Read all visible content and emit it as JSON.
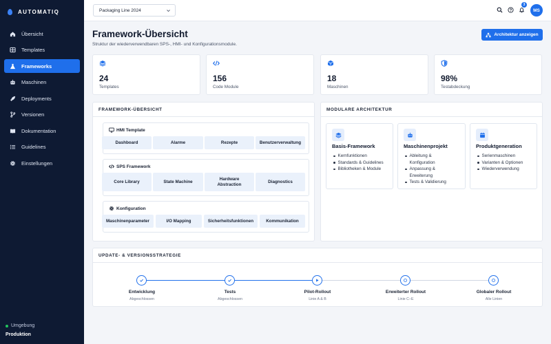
{
  "app": {
    "name": "AUTOMATIQ"
  },
  "nav": [
    {
      "label": "Übersicht",
      "icon": "home-icon"
    },
    {
      "label": "Templates",
      "icon": "grid-icon"
    },
    {
      "label": "Frameworks",
      "icon": "flask-icon",
      "active": true
    },
    {
      "label": "Maschinen",
      "icon": "robot-icon"
    },
    {
      "label": "Deployments",
      "icon": "rocket-icon"
    },
    {
      "label": "Versionen",
      "icon": "branch-icon"
    },
    {
      "label": "Dokumentation",
      "icon": "book-icon"
    },
    {
      "label": "Guidelines",
      "icon": "checklist-icon"
    },
    {
      "label": "Einstellungen",
      "icon": "gear-icon"
    }
  ],
  "environment": {
    "label": "Umgebung",
    "value": "Produktion",
    "status_color": "#22c55e"
  },
  "topbar": {
    "project_select": "Packaging Line 2024",
    "notification_count": "3",
    "avatar_initials": "MS"
  },
  "header": {
    "title": "Framework-Übersicht",
    "subtitle": "Struktur der wiederverwendbaren SPS-, HMI- und Konfigurationsmodule.",
    "action_label": "Architektur anzeigen"
  },
  "stats": [
    {
      "value": "24",
      "label": "Templates",
      "icon": "layers-icon"
    },
    {
      "value": "156",
      "label": "Code Module",
      "icon": "code-icon"
    },
    {
      "value": "18",
      "label": "Maschinen",
      "icon": "cube-icon"
    },
    {
      "value": "98%",
      "label": "Testabdeckung",
      "icon": "shield-icon"
    }
  ],
  "framework_panel": {
    "title": "FRAMEWORK-ÜBERSICHT",
    "groups": [
      {
        "title": "HMI Template",
        "icon": "monitor-icon",
        "items": [
          "Dashboard",
          "Alarme",
          "Rezepte",
          "Benutzerverwaltung"
        ]
      },
      {
        "title": "SPS Framework",
        "icon": "code-icon",
        "items": [
          "Core Library",
          "State Machine",
          "Hardware Abstraction",
          "Diagnostics"
        ]
      },
      {
        "title": "Konfiguration",
        "icon": "gear-icon",
        "items": [
          "Maschinenparameter",
          "I/O Mapping",
          "Sicherheitsfunktionen",
          "Kommunikation"
        ]
      }
    ]
  },
  "architecture_panel": {
    "title": "MODULARE ARCHITEKTUR",
    "modules": [
      {
        "title": "Basis-Framework",
        "icon": "layers-icon",
        "items": [
          "Kernfunktionen",
          "Standards & Guidelines",
          "Bibliotheken & Module"
        ]
      },
      {
        "title": "Maschinenprojekt",
        "icon": "robot-icon",
        "items": [
          "Ableitung & Konfiguration",
          "Anpassung & Erweiterung",
          "Tests & Validierung"
        ]
      },
      {
        "title": "Produktgeneration",
        "icon": "calendar-icon",
        "items": [
          "Serienmaschinen",
          "Varianten & Optionen",
          "Wiederverwendung"
        ]
      }
    ]
  },
  "strategy_panel": {
    "title": "UPDATE- & VERSIONSSTRATEGIE",
    "steps": [
      {
        "label": "Entwicklung",
        "status": "Abgeschlossen",
        "icon": "check-icon"
      },
      {
        "label": "Tests",
        "status": "Abgeschlossen",
        "icon": "check-icon"
      },
      {
        "label": "Pilot-Rollout",
        "status": "Linie A & B",
        "icon": "play-icon"
      },
      {
        "label": "Erweiterter Rollout",
        "status": "Linie C–E",
        "icon": "circle-icon"
      },
      {
        "label": "Globaler Rollout",
        "status": "Alle Linien",
        "icon": "circle-icon"
      }
    ]
  },
  "colors": {
    "accent": "#1f6feb",
    "sidebar": "#0e1a33",
    "chip": "#eaf1fb"
  }
}
